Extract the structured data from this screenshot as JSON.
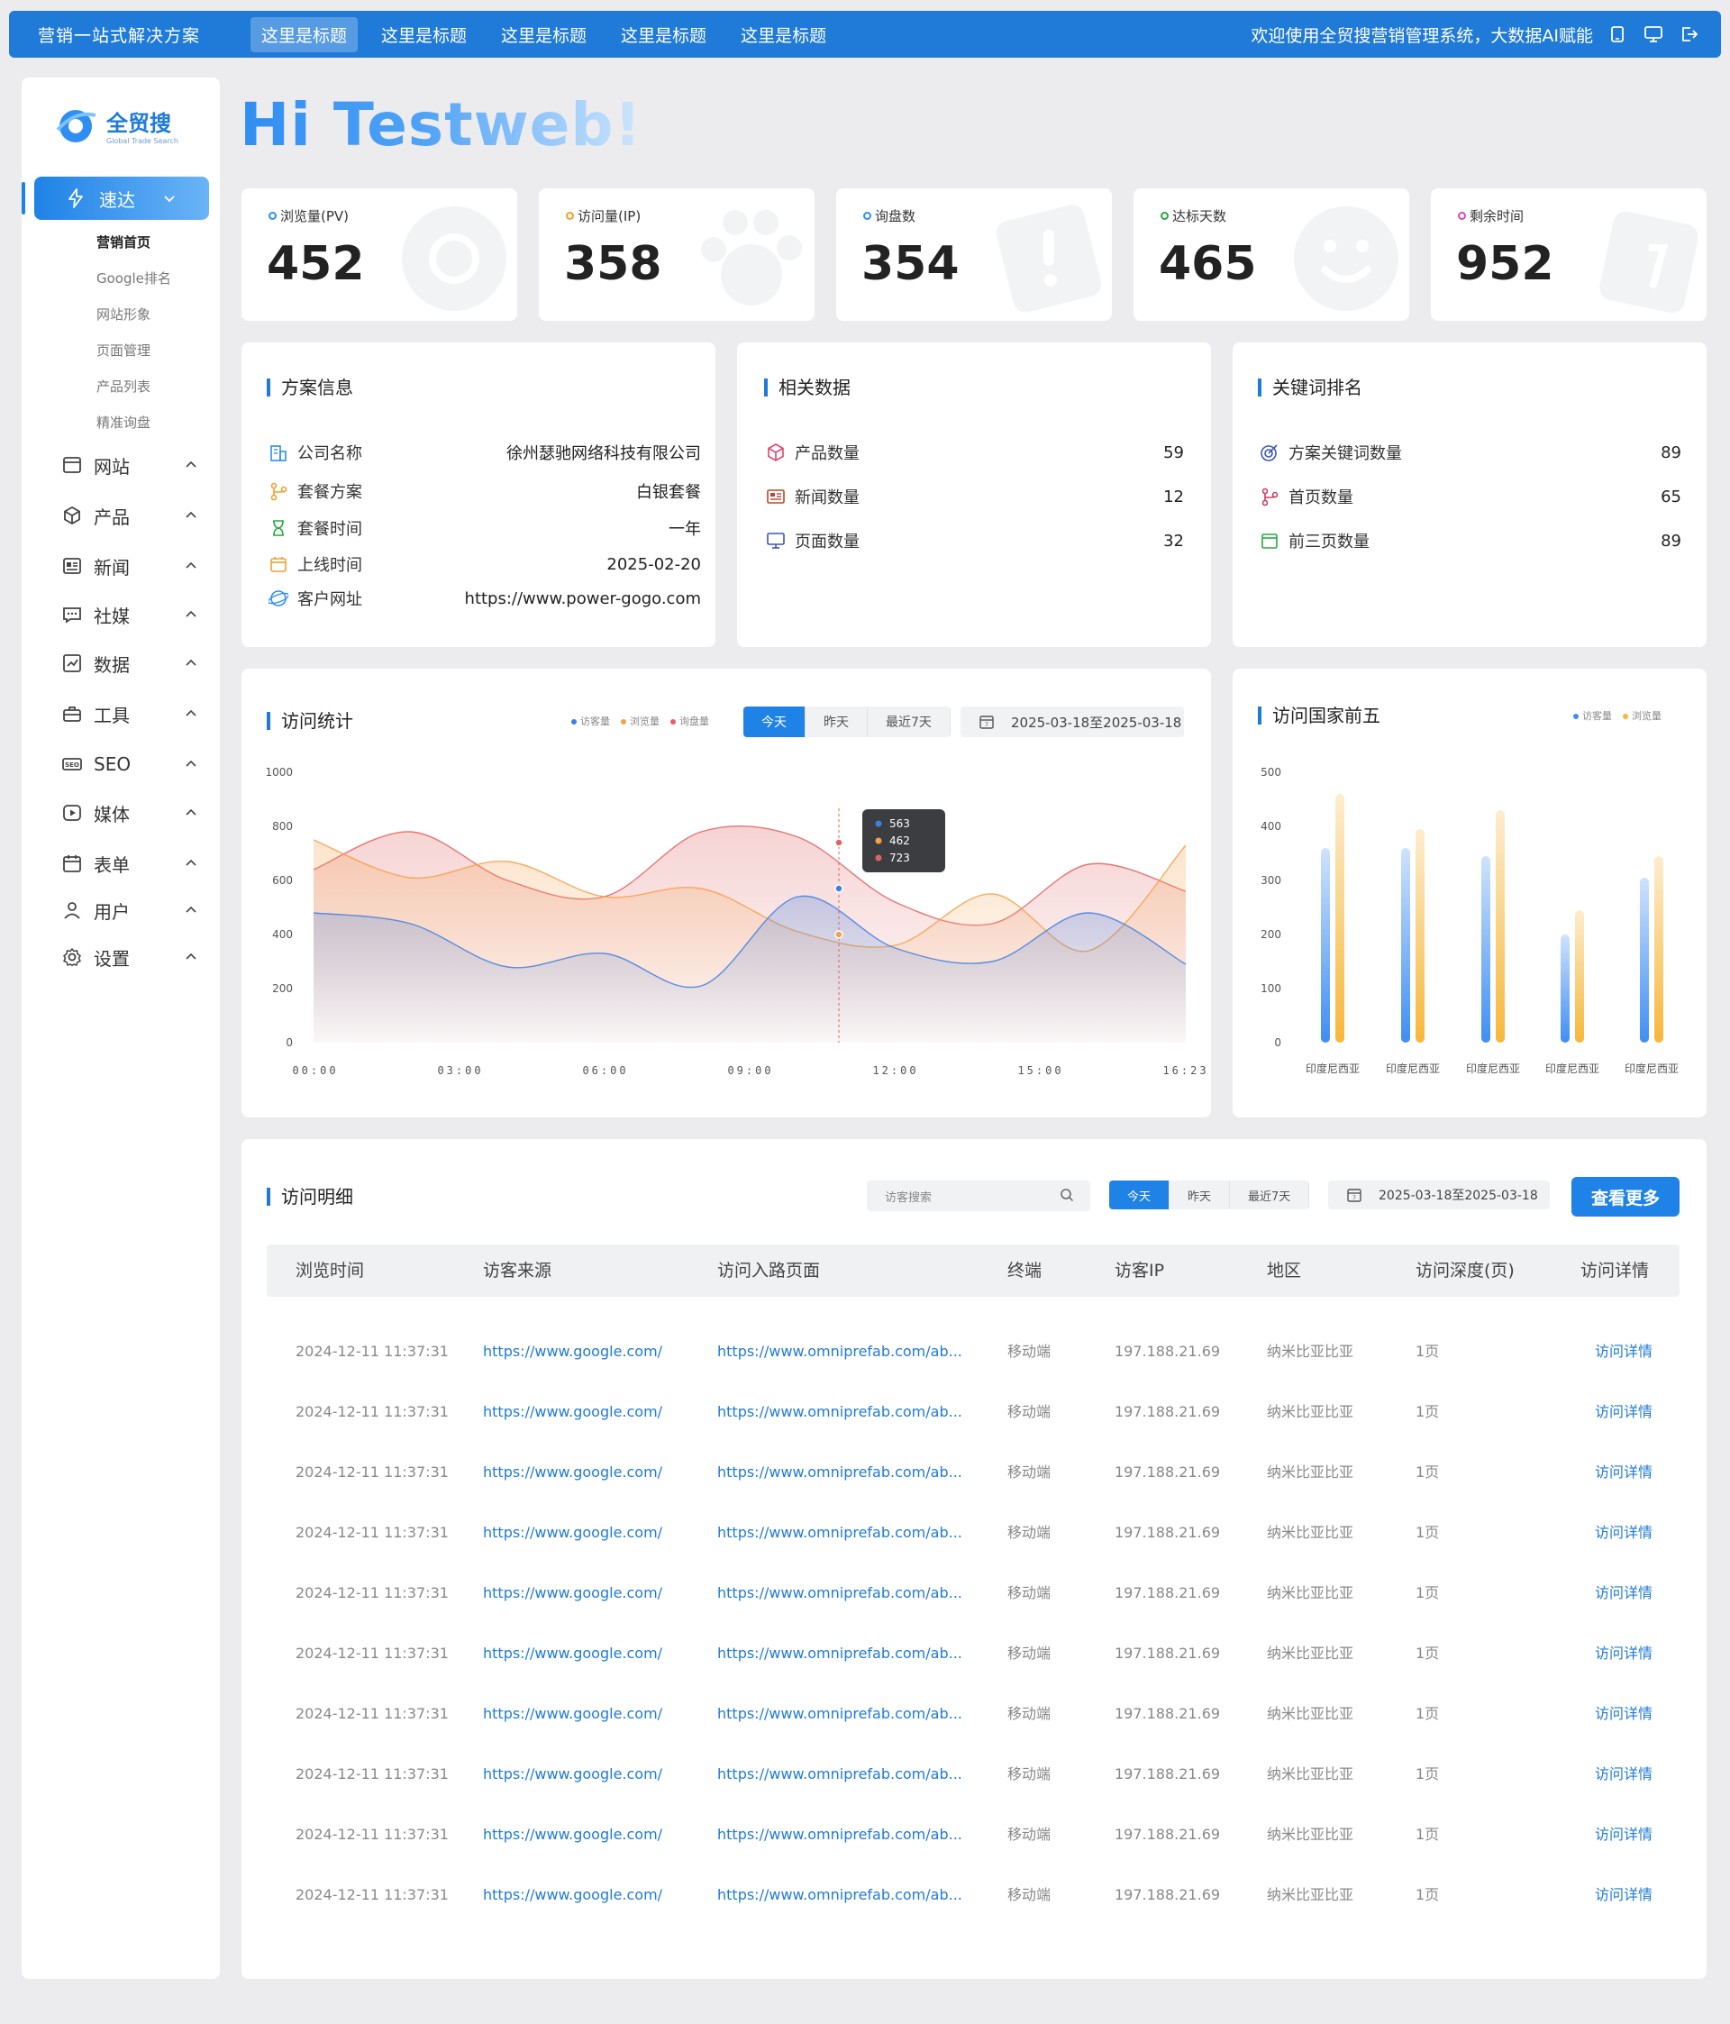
{
  "topbar": {
    "brand": "营销一站式解决方案",
    "tabs": [
      "这里是标题",
      "这里是标题",
      "这里是标题",
      "这里是标题",
      "这里是标题"
    ],
    "welcome": "欢迎使用全贸搜营销管理系统，大数据AI赋能"
  },
  "sidebar": {
    "logo_name": "全贸搜",
    "logo_sub": "Global Trade Search",
    "active": "速达",
    "subitems": [
      "营销首页",
      "Google排名",
      "网站形象",
      "页面管理",
      "产品列表",
      "精准询盘"
    ],
    "menu": [
      "网站",
      "产品",
      "新闻",
      "社媒",
      "数据",
      "工具",
      "SEO",
      "媒体",
      "表单",
      "用户",
      "设置"
    ]
  },
  "greeting": "Hi Testweb!",
  "stats": [
    {
      "label": "浏览量(PV)",
      "value": "452",
      "color": "#2f8ef2"
    },
    {
      "label": "访问量(IP)",
      "value": "358",
      "color": "#f0a12c"
    },
    {
      "label": "询盘数",
      "value": "354",
      "color": "#2f8ef2"
    },
    {
      "label": "达标天数",
      "value": "465",
      "color": "#27a844"
    },
    {
      "label": "剩余时间",
      "value": "952",
      "color": "#d44bb7"
    }
  ],
  "plan": {
    "title": "方案信息",
    "rows": [
      {
        "k": "公司名称",
        "v": "徐州瑟驰网络科技有限公司"
      },
      {
        "k": "套餐方案",
        "v": "白银套餐"
      },
      {
        "k": "套餐时间",
        "v": "一年"
      },
      {
        "k": "上线时间",
        "v": "2025-02-20"
      },
      {
        "k": "客户网址",
        "v": "https://www.power-gogo.com"
      }
    ]
  },
  "related": {
    "title": "相关数据",
    "rows": [
      {
        "k": "产品数量",
        "v": "59"
      },
      {
        "k": "新闻数量",
        "v": "12"
      },
      {
        "k": "页面数量",
        "v": "32"
      }
    ]
  },
  "keywords": {
    "title": "关键词排名",
    "rows": [
      {
        "k": "方案关键词数量",
        "v": "89"
      },
      {
        "k": "首页数量",
        "v": "65"
      },
      {
        "k": "前三页数量",
        "v": "89"
      }
    ]
  },
  "visits": {
    "title": "访问统计",
    "range_tabs": [
      "今天",
      "昨天",
      "最近7天"
    ],
    "date_range": "2025-03-18至2025-03-18"
  },
  "countries": {
    "title": "访问国家前五"
  },
  "chart_data": [
    {
      "type": "area",
      "x": [
        "00:00",
        "03:00",
        "06:00",
        "09:00",
        "12:00",
        "15:00",
        "16:23"
      ],
      "ylim": [
        0,
        1000
      ],
      "yticks": [
        0,
        200,
        400,
        600,
        800,
        1000
      ],
      "series": [
        {
          "name": "访客量",
          "color": "#3f7fe0",
          "values": [
            480,
            440,
            280,
            330,
            210,
            540,
            350,
            300,
            480,
            290
          ]
        },
        {
          "name": "浏览量",
          "color": "#f5a04a",
          "values": [
            750,
            610,
            670,
            540,
            570,
            410,
            360,
            550,
            340,
            730
          ]
        },
        {
          "name": "询盘量",
          "color": "#e06262",
          "values": [
            640,
            780,
            600,
            540,
            780,
            760,
            520,
            440,
            660,
            560
          ]
        }
      ],
      "tooltip": [
        "563",
        "462",
        "723"
      ]
    },
    {
      "type": "bar",
      "categories": [
        "印度尼西亚",
        "印度尼西亚",
        "印度尼西亚",
        "印度尼西亚",
        "印度尼西亚"
      ],
      "ylim": [
        0,
        500
      ],
      "yticks": [
        0,
        100,
        200,
        300,
        400,
        500
      ],
      "series": [
        {
          "name": "访客量",
          "color": "#3f8ef2",
          "values": [
            360,
            360,
            345,
            200,
            305
          ]
        },
        {
          "name": "浏览量",
          "color": "#f7b73b",
          "values": [
            460,
            395,
            430,
            245,
            345
          ]
        }
      ]
    }
  ],
  "detail": {
    "title": "访问明细",
    "search_placeholder": "访客搜索",
    "range_tabs": [
      "今天",
      "昨天",
      "最近7天"
    ],
    "date_range": "2025-03-18至2025-03-18",
    "more": "查看更多",
    "columns": [
      "浏览时间",
      "访客来源",
      "访问入路页面",
      "终端",
      "访客IP",
      "地区",
      "访问深度(页)",
      "访问详情"
    ],
    "rows": [
      [
        "2024-12-11 11:37:31",
        "https://www.google.com/",
        "https://www.omniprefab.com/ab...",
        "移动端",
        "197.188.21.69",
        "纳米比亚比亚",
        "1页",
        "访问详情"
      ],
      [
        "2024-12-11 11:37:31",
        "https://www.google.com/",
        "https://www.omniprefab.com/ab...",
        "移动端",
        "197.188.21.69",
        "纳米比亚比亚",
        "1页",
        "访问详情"
      ],
      [
        "2024-12-11 11:37:31",
        "https://www.google.com/",
        "https://www.omniprefab.com/ab...",
        "移动端",
        "197.188.21.69",
        "纳米比亚比亚",
        "1页",
        "访问详情"
      ],
      [
        "2024-12-11 11:37:31",
        "https://www.google.com/",
        "https://www.omniprefab.com/ab...",
        "移动端",
        "197.188.21.69",
        "纳米比亚比亚",
        "1页",
        "访问详情"
      ],
      [
        "2024-12-11 11:37:31",
        "https://www.google.com/",
        "https://www.omniprefab.com/ab...",
        "移动端",
        "197.188.21.69",
        "纳米比亚比亚",
        "1页",
        "访问详情"
      ],
      [
        "2024-12-11 11:37:31",
        "https://www.google.com/",
        "https://www.omniprefab.com/ab...",
        "移动端",
        "197.188.21.69",
        "纳米比亚比亚",
        "1页",
        "访问详情"
      ],
      [
        "2024-12-11 11:37:31",
        "https://www.google.com/",
        "https://www.omniprefab.com/ab...",
        "移动端",
        "197.188.21.69",
        "纳米比亚比亚",
        "1页",
        "访问详情"
      ],
      [
        "2024-12-11 11:37:31",
        "https://www.google.com/",
        "https://www.omniprefab.com/ab...",
        "移动端",
        "197.188.21.69",
        "纳米比亚比亚",
        "1页",
        "访问详情"
      ],
      [
        "2024-12-11 11:37:31",
        "https://www.google.com/",
        "https://www.omniprefab.com/ab...",
        "移动端",
        "197.188.21.69",
        "纳米比亚比亚",
        "1页",
        "访问详情"
      ],
      [
        "2024-12-11 11:37:31",
        "https://www.google.com/",
        "https://www.omniprefab.com/ab...",
        "移动端",
        "197.188.21.69",
        "纳米比亚比亚",
        "1页",
        "访问详情"
      ]
    ]
  }
}
